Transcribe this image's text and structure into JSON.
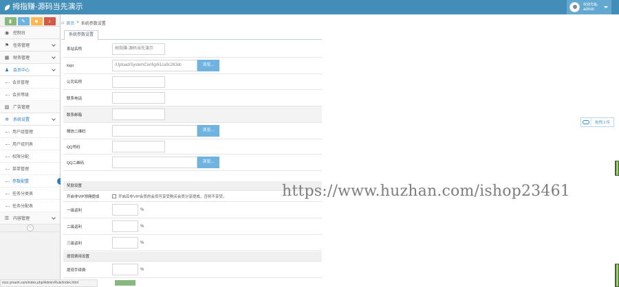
{
  "header": {
    "title": "拇指赚-源码当先演示",
    "welcome": "欢迎光临,",
    "username": "admin"
  },
  "sidebar": {
    "shortcuts": [
      {
        "icon": "signal-icon",
        "glyph": "▮",
        "color": "#87b87f"
      },
      {
        "icon": "pencil-icon",
        "glyph": "✎",
        "color": "#6fb3e0"
      },
      {
        "icon": "users-icon",
        "glyph": "☻",
        "color": "#ffb752"
      },
      {
        "icon": "cogs-icon",
        "glyph": "♪",
        "color": "#d15b47"
      }
    ],
    "items": [
      {
        "label": "控制台",
        "icon": "dashboard-icon",
        "glyph": "◉"
      },
      {
        "label": "任务管理",
        "icon": "flag-icon",
        "glyph": "⚑"
      },
      {
        "label": "财务管理",
        "icon": "calendar-icon",
        "glyph": "▦"
      },
      {
        "label": "会员中心",
        "icon": "user-icon",
        "glyph": "♟"
      },
      {
        "label": "会员管理"
      },
      {
        "label": "会员等级"
      },
      {
        "label": "广告管理",
        "icon": "picture-icon",
        "glyph": "▧"
      },
      {
        "label": "系统设置",
        "icon": "gear-icon",
        "glyph": "✲"
      },
      {
        "label": "用户组管理"
      },
      {
        "label": "用户组列表"
      },
      {
        "label": "权限分配"
      },
      {
        "label": "菜单管理"
      },
      {
        "label": "参数配置"
      },
      {
        "label": "任务分类表"
      },
      {
        "label": "任务分配表"
      },
      {
        "label": "内容管理",
        "icon": "list-icon",
        "glyph": "☰"
      }
    ],
    "collapse_glyph": "«"
  },
  "breadcrumb": {
    "home": "首页",
    "separator": ">",
    "current": "系统参数设置"
  },
  "tab": "系统参数设置",
  "form": {
    "site_name": {
      "label": "系站名称",
      "value": "拇指赚-源码当先演示"
    },
    "logo": {
      "label": "logo",
      "value": "/Upload/SystemConfig/61ca9c263dc",
      "button": "浏览..."
    },
    "company_name": {
      "label": "公司名称",
      "value": ""
    },
    "phone": {
      "label": "联系电话",
      "value": ""
    },
    "email": {
      "label": "联系邮箱",
      "value": ""
    },
    "wechat_qr": {
      "label": "微信二维码",
      "value": "",
      "button": "浏览..."
    },
    "qq": {
      "label": "QQ号码",
      "value": ""
    },
    "qq_qr": {
      "label": "QQ二维码",
      "value": "",
      "button": "浏览..."
    },
    "section_reward": "奖励设置",
    "vip_toggle": {
      "label": "开启非VIP领佣提成",
      "text": "开启后非VIP会员的会员可享受购买会员分享提成，否则不享受。"
    },
    "level1": {
      "label": "一级返利",
      "value": "",
      "unit": "%"
    },
    "level2": {
      "label": "二级返利",
      "value": "",
      "unit": "%"
    },
    "level3": {
      "label": "三级返利",
      "value": "",
      "unit": "%"
    },
    "section_withdraw": "提现费用设置",
    "fee": {
      "label": "提现手续费",
      "value": "",
      "unit": "%"
    }
  },
  "widget": {
    "label": "拖拽上传"
  },
  "watermark": "https://www.huzhan.com/ishop23461",
  "statusbar": "mzz.ymaoh.com/index.php/Admin/Rule/index.html"
}
